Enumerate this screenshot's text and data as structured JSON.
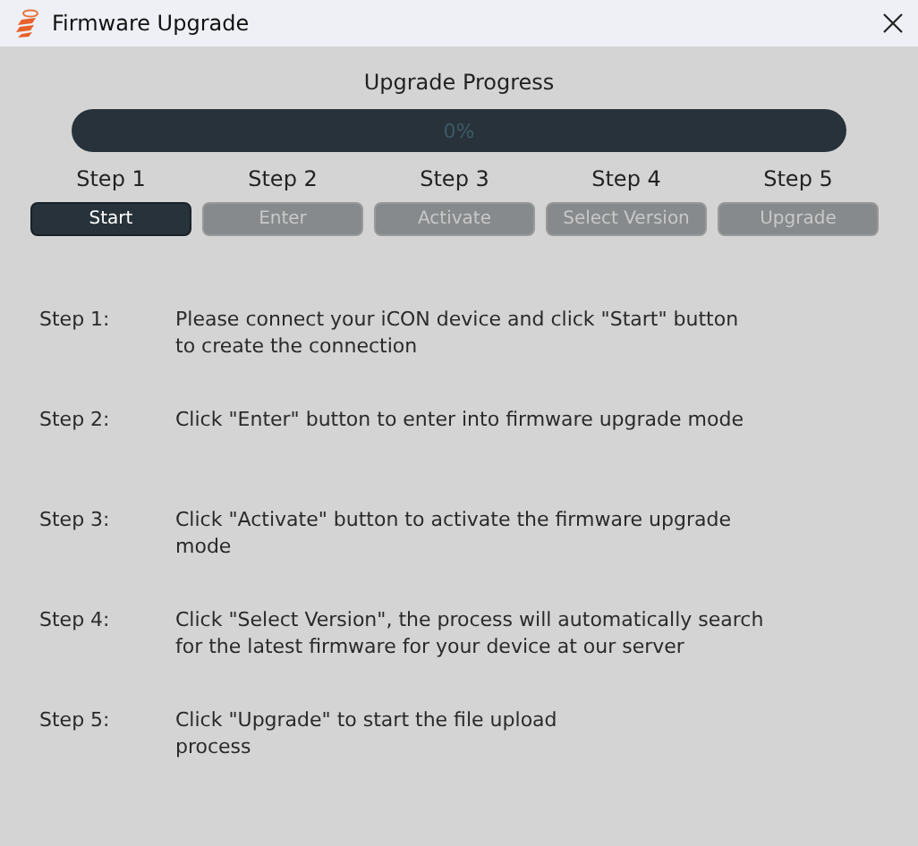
{
  "window": {
    "title": "Firmware Upgrade"
  },
  "progress": {
    "title": "Upgrade Progress",
    "level": 0,
    "reading": "0%"
  },
  "steps": [
    {
      "label": "Step 1",
      "button": "Start",
      "disabled": false
    },
    {
      "label": "Step 2",
      "button": "Enter",
      "disabled": true
    },
    {
      "label": "Step 3",
      "button": "Activate",
      "disabled": true
    },
    {
      "label": "Step 4",
      "button": "Select Version",
      "disabled": true
    },
    {
      "label": "Step 5",
      "button": "Upgrade",
      "disabled": true
    }
  ],
  "instructions": [
    {
      "label": "Step 1:",
      "text": "Please connect your iCON device and click \"Start\" button\nto create the connection"
    },
    {
      "label": "Step 2:",
      "text": "Click \"Enter\" button to enter into firmware upgrade mode"
    },
    {
      "label": "Step 3:",
      "text": "Click \"Activate\" button to activate the firmware upgrade\nmode"
    },
    {
      "label": "Step 4:",
      "text": "Click \"Select Version\", the process will automatically search\nfor the latest firmware for your device at our server"
    },
    {
      "label": "Step 5:",
      "text": "Click \"Upgrade\" to start the file upload\nprocess"
    }
  ]
}
